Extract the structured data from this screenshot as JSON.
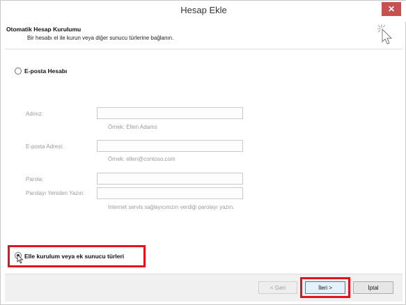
{
  "window": {
    "title": "Hesap Ekle",
    "close_label": "✕"
  },
  "header": {
    "title": "Otomatik Hesap Kurulumu",
    "subtitle": "Bir hesabı el ile kurun veya diğer sunucu türlerine bağlanın."
  },
  "options": {
    "email_account": {
      "label": "E-posta Hesabı",
      "selected": false
    },
    "manual_setup": {
      "label": "Elle kurulum veya ek sunucu türleri",
      "selected": true
    }
  },
  "form": {
    "name": {
      "label": "Adınız:",
      "value": "",
      "hint": "Örnek: Ellen Adams"
    },
    "email": {
      "label": "E-posta Adresi:",
      "value": "",
      "hint": "Örnek: ellen@contoso.com"
    },
    "password": {
      "label": "Parola:",
      "value": ""
    },
    "password_confirm": {
      "label": "Parolayı Yeniden Yazın:",
      "value": "",
      "hint": "Internet servis sağlayıcınızın verdiği parolayı yazın."
    }
  },
  "footer": {
    "back_label": "< Geri",
    "next_label": "İleri >",
    "cancel_label": "İptal"
  },
  "colors": {
    "highlight": "#e0141a",
    "close_button": "#c75050"
  }
}
